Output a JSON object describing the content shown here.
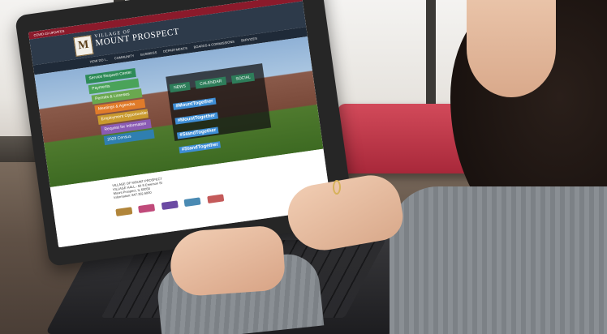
{
  "site": {
    "covid_banner": "COVID-19 UPDATES",
    "logo_letter": "M",
    "title_small": "VILLAGE OF",
    "title_big": "MOUNT PROSPECT",
    "nav_items": [
      "HOW DO I...",
      "COMMUNITY",
      "BUSINESS",
      "DEPARTMENTS",
      "BOARDS & COMMISSIONS",
      "SERVICES"
    ],
    "tiles": [
      {
        "label": "Service Request Center",
        "color": "#2e8b57"
      },
      {
        "label": "Payments",
        "color": "#4aa35a"
      },
      {
        "label": "Permits & Licenses",
        "color": "#6aa84f"
      },
      {
        "label": "Meetings & Agendas",
        "color": "#e07b2a"
      },
      {
        "label": "Employment Opportunities",
        "color": "#c99a2e"
      },
      {
        "label": "Request for Information",
        "color": "#8a5bb3"
      },
      {
        "label": "2020 Census",
        "color": "#2f7fb0"
      }
    ],
    "news_tabs": [
      "NEWS",
      "CALENDAR",
      "SOCIAL"
    ],
    "hashtags": [
      "#MountTogether",
      "#MountTogether",
      "#StandTogether",
      "#StandTogether"
    ],
    "footer_lines": [
      "VILLAGE OF MOUNT PROSPECT",
      "VILLAGE HALL - 50 S Emerson St",
      "Mount Prospect, IL 60056",
      "Information: 847.392.6000"
    ],
    "sponsors": [
      "#b1853a",
      "#c04a7a",
      "#6b4aa3",
      "#4a8ab3",
      "#c45a5a"
    ]
  }
}
